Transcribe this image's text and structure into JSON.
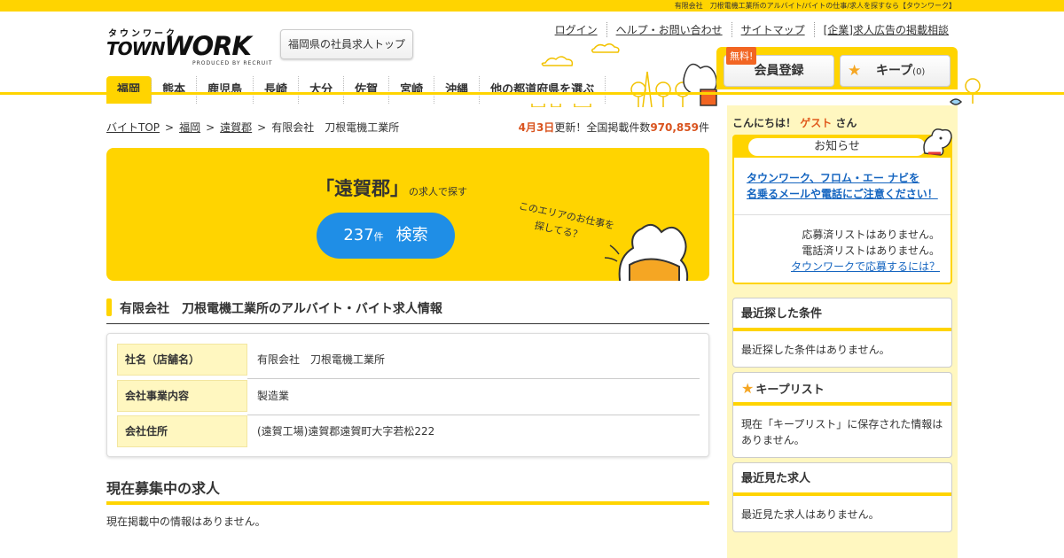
{
  "topbar": {
    "text": "有限会社　刀根電機工業所のアルバイト/バイトの仕事/求人を探すなら【タウンワーク】"
  },
  "logo": {
    "kana": "タウンワーク",
    "word_a": "TOWN",
    "word_b": "WORK",
    "by": "PRODUCED BY RECRUIT"
  },
  "header": {
    "top_button": "福岡県の社員求人トップ",
    "links": [
      "ログイン",
      "ヘルプ・お問い合わせ",
      "サイトマップ",
      "[企業]求人広告の掲載相談"
    ],
    "free_tag": "無料!",
    "member_button": "会員登録",
    "keep_button": "キープ",
    "keep_count": "(0)"
  },
  "prefnav": [
    "福岡",
    "熊本",
    "鹿児島",
    "長崎",
    "大分",
    "佐賀",
    "宮崎",
    "沖縄",
    "他の都道府県を選ぶ"
  ],
  "breadcrumb": {
    "items": [
      "バイトTOP",
      "福岡",
      "遠賀郡"
    ],
    "current": "有限会社　刀根電機工業所"
  },
  "update": {
    "date": "4月3日",
    "mid": "更新！全国掲載件数",
    "count": "970,859",
    "unit": "件"
  },
  "search_panel": {
    "area": "「遠賀郡」",
    "area_suffix": "の求人で探す",
    "count": "237",
    "count_unit": "件",
    "button": "検索",
    "copy_line1": "このエリアのお仕事を",
    "copy_line2": "探してる？"
  },
  "section_title": "有限会社　刀根電機工業所のアルバイト・バイト求人情報",
  "company": [
    {
      "label": "社名（店舗名）",
      "value": "有限会社　刀根電機工業所"
    },
    {
      "label": "会社事業内容",
      "value": "製造業"
    },
    {
      "label": "会社住所",
      "value": "(遠賀工場)遠賀郡遠賀町大字若松222"
    }
  ],
  "jobs": {
    "title": "現在募集中の求人",
    "none": "現在掲載中の情報はありません。"
  },
  "sidebar": {
    "greeting": "こんにちは！",
    "guest": "ゲスト",
    "san": "さん",
    "notice_title": "お知らせ",
    "notice_link1": "タウンワーク、フロム・エー ナビを",
    "notice_link2": "名乗るメールや電話にご注意ください！",
    "applied": "応募済リストはありません。",
    "called": "電話済リストはありません。",
    "how_to": "タウンワークで応募するには？",
    "recent_search_title": "最近探した条件",
    "recent_search_body": "最近探した条件はありません。",
    "keep_title": "キープリスト",
    "keep_body": "現在「キープリスト」に保存された情報はありません。",
    "recent_view_title": "最近見た求人",
    "recent_view_body": "最近見た求人はありません。"
  }
}
